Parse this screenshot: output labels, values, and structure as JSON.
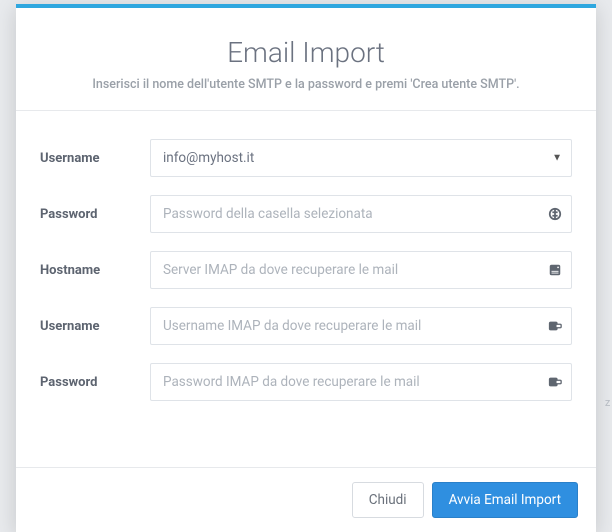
{
  "header": {
    "title": "Email Import",
    "subtitle": "Inserisci il nome dell'utente SMTP e la password e premi 'Crea utente SMTP'."
  },
  "form": {
    "username_select": {
      "label": "Username",
      "selected": "info@myhost.it"
    },
    "password": {
      "label": "Password",
      "placeholder": "Password della casella selezionata"
    },
    "hostname": {
      "label": "Hostname",
      "placeholder": "Server IMAP da dove recuperare le mail"
    },
    "imap_username": {
      "label": "Username",
      "placeholder": "Username IMAP da dove recuperare le mail"
    },
    "imap_password": {
      "label": "Password",
      "placeholder": "Password IMAP da dove recuperare le mail"
    }
  },
  "footer": {
    "close": "Chiudi",
    "submit": "Avvia Email Import"
  }
}
